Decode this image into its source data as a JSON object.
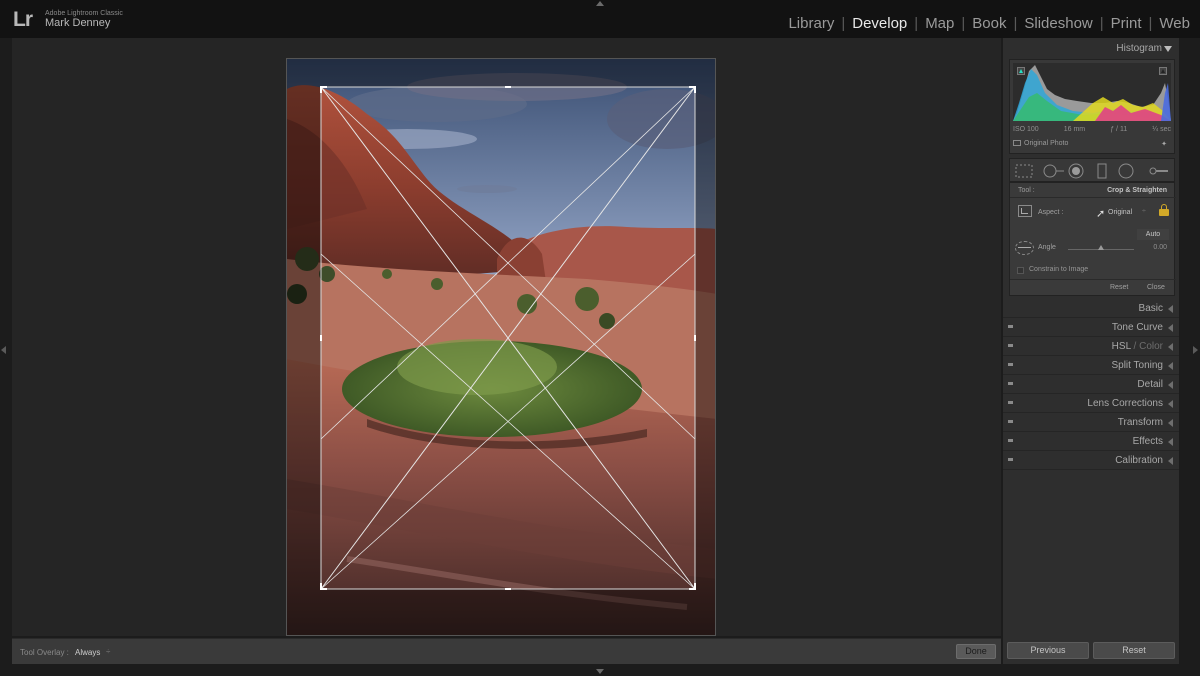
{
  "identity": {
    "logo": "Lr",
    "app_name": "Adobe Lightroom Classic",
    "user_name": "Mark Denney"
  },
  "modules": [
    {
      "label": "Library",
      "active": false
    },
    {
      "label": "Develop",
      "active": true
    },
    {
      "label": "Map",
      "active": false
    },
    {
      "label": "Book",
      "active": false
    },
    {
      "label": "Slideshow",
      "active": false
    },
    {
      "label": "Print",
      "active": false
    },
    {
      "label": "Web",
      "active": false
    }
  ],
  "module_separator": "|",
  "histogram": {
    "title": "Histogram",
    "iso": "ISO 100",
    "focal": "16 mm",
    "aperture": "ƒ / 11",
    "shutter": "¼ sec",
    "original_label": "Original Photo"
  },
  "crop_panel": {
    "tool_label": "Tool :",
    "tool_value": "Crop & Straighten",
    "aspect_label": "Aspect :",
    "aspect_value": "Original",
    "auto_label": "Auto",
    "angle_label": "Angle",
    "angle_value": "0.00",
    "angle_level": 0.5,
    "constrain_label": "Constrain to Image",
    "constrain_checked": false,
    "reset_label": "Reset",
    "close_label": "Close"
  },
  "sections": [
    {
      "label": "Basic",
      "switch": false
    },
    {
      "label": "Tone Curve",
      "switch": true
    },
    {
      "label": "HSL",
      "suffix": " / Color",
      "switch": true
    },
    {
      "label": "Split Toning",
      "switch": true
    },
    {
      "label": "Detail",
      "switch": true
    },
    {
      "label": "Lens Corrections",
      "switch": true
    },
    {
      "label": "Transform",
      "switch": true
    },
    {
      "label": "Effects",
      "switch": true
    },
    {
      "label": "Calibration",
      "switch": true
    }
  ],
  "toolbar": {
    "overlay_label": "Tool Overlay :",
    "overlay_value": "Always",
    "overlay_caret": "÷",
    "done_label": "Done"
  },
  "bottom_buttons": {
    "previous_label": "Previous",
    "reset_label": "Reset"
  },
  "colors": {
    "accent_lock": "#d2a928",
    "clip_shadow": "#27e0c4"
  }
}
